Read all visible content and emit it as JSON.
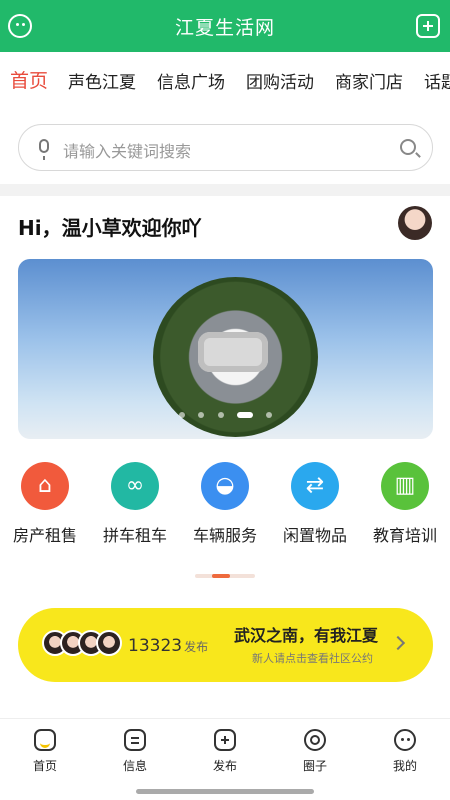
{
  "header": {
    "title": "江夏生活网"
  },
  "tabs": [
    {
      "label": "首页",
      "active": true
    },
    {
      "label": "声色江夏",
      "active": false
    },
    {
      "label": "信息广场",
      "active": false
    },
    {
      "label": "团购活动",
      "active": false
    },
    {
      "label": "商家门店",
      "active": false
    },
    {
      "label": "话题",
      "active": false
    }
  ],
  "search": {
    "placeholder": "请输入关键词搜索"
  },
  "greeting": "Hi，温小草欢迎你吖",
  "banner": {
    "slide_count": 5,
    "active_slide": 3
  },
  "categories": [
    {
      "label": "房产租售",
      "icon": "house-icon",
      "color": "#f15a3c"
    },
    {
      "label": "拼车租车",
      "icon": "carpool-icon",
      "color": "#22b8a3"
    },
    {
      "label": "车辆服务",
      "icon": "car-icon",
      "color": "#3b8ff0"
    },
    {
      "label": "闲置物品",
      "icon": "basket-icon",
      "color": "#2aa8ee"
    },
    {
      "label": "教育培训",
      "icon": "book-icon",
      "color": "#59c23b"
    }
  ],
  "promo": {
    "count": "13323",
    "count_suffix": "发布",
    "main": "武汉之南，有我江夏",
    "sub": "新人请点击查看社区公约",
    "color": "#f8e71c"
  },
  "bottom_nav": [
    {
      "label": "首页",
      "icon": "home-icon"
    },
    {
      "label": "信息",
      "icon": "message-icon"
    },
    {
      "label": "发布",
      "icon": "add-icon"
    },
    {
      "label": "圈子",
      "icon": "circle-icon"
    },
    {
      "label": "我的",
      "icon": "profile-icon"
    }
  ],
  "colors": {
    "brand_green": "#21b96a",
    "active_tab_red": "#e84c3d"
  }
}
